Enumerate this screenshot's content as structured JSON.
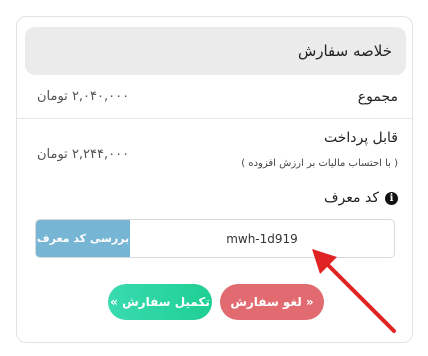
{
  "summary": {
    "title": "خلاصه سفارش",
    "subtotal_label": "مجموع",
    "subtotal_value": "۲,۰۴۰,۰۰۰ تومان",
    "payable_label": "قابل پرداخت",
    "payable_note": "( با احتساب مالیات بر ارزش افزوده )",
    "payable_value": "۲,۲۴۴,۰۰۰ تومان"
  },
  "coupon": {
    "label": "کد معرف",
    "info_icon": "info-circle-icon",
    "input_value": "mwh-1d919",
    "check_button": "بررسی کد معرف"
  },
  "actions": {
    "complete_label": "تکمیل سفارش »",
    "cancel_label": "« لغو سفارش"
  },
  "colors": {
    "header_bg": "#ebebeb",
    "check_button": "#77b5d4",
    "complete_button": "#1fcf93",
    "cancel_button": "#e16b70",
    "annotation_arrow": "#e02424"
  }
}
